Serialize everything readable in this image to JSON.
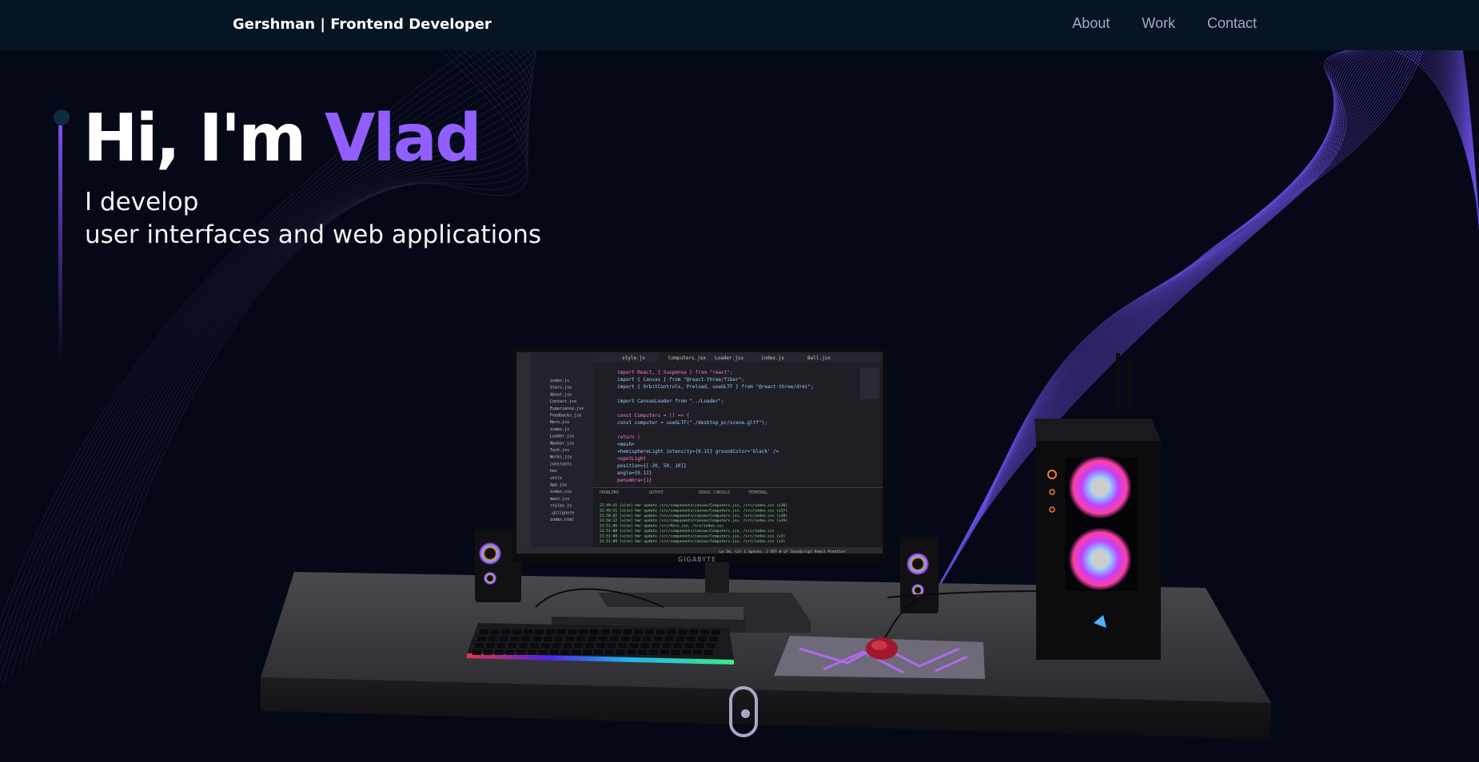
{
  "nav": {
    "brand": "Gershman  | Frontend Developer",
    "links": [
      "About",
      "Work",
      "Contact"
    ]
  },
  "hero": {
    "greeting": "Hi, I'm ",
    "name": "Vlad",
    "line1": "I develop",
    "line2": "user interfaces and web applications"
  },
  "colors": {
    "background": "#050816",
    "nav": "#051524",
    "accent": "#915eff",
    "muted": "#aaa6c3"
  },
  "monitor": {
    "brand": "GIGABYTE",
    "tabs": [
      "style.js",
      "Computers.jsx",
      "Loader.jsx",
      "index.js",
      "Ball.jsx"
    ],
    "code_lines": [
      "import React, { Suspense } from \"react\";",
      "import { Canvas } from \"@react-three/fiber\";",
      "import { OrbitControls, Preload, useGLTF } from \"@react-three/drei\";",
      "",
      "import CanvasLoader from \"../Loader\";",
      "",
      "const Computers = () => {",
      "  const computer = useGLTF(\"./desktop_pc/scene.gltf\");",
      "",
      "  return (",
      "    <mesh>",
      "      <hemisphereLight intensity={0.15} groundColor='black' />",
      "      <spotLight",
      "        position={[-20, 50, 10]}",
      "        angle={0.12}",
      "        penumbra={1}"
    ],
    "files": [
      "index.js",
      "Stars.jsx",
      "About.jsx",
      "Contact.jsx",
      "Experience.jsx",
      "Feedbacks.jsx",
      "Hero.jsx",
      "index.js",
      "Loader.jsx",
      "Navbar.jsx",
      "Tech.jsx",
      "Works.jsx",
      "constants",
      "hoc",
      "utils",
      "App.jsx",
      "index.css",
      "main.jsx",
      "styles.js",
      ".gitignore",
      "index.html"
    ],
    "panel_tabs": [
      "PROBLEMS",
      "OUTPUT",
      "DEBUG CONSOLE",
      "TERMINAL"
    ],
    "terminal_lines": [
      "22:49:41 [vite] hmr update /src/components/canvas/Computers.jsx, /src/index.css (x36)",
      "22:49:51 [vite] hmr update /src/components/canvas/Computers.jsx, /src/index.css (x37)",
      "22:50:02 [vite] hmr update /src/components/canvas/Computers.jsx, /src/index.css (x38)",
      "22:50:12 [vite] hmr update /src/components/canvas/Computers.jsx, /src/index.css (x39)",
      "22:51:06 [vite] hmr update /src/Hero.jsx, /src/index.css",
      "22:51:08 [vite] hmr update /src/components/canvas/Computers.jsx, /src/index.css",
      "22:51:08 [vite] hmr update /src/components/canvas/Computers.jsx, /src/index.css (x2)",
      "22:51:09 [vite] hmr update /src/components/canvas/Computers.jsx, /src/index.css (x3)"
    ],
    "status": "Ln 56, Col 1   Spaces: 2   UTF-8   LF   JavaScript React   Prettier"
  }
}
